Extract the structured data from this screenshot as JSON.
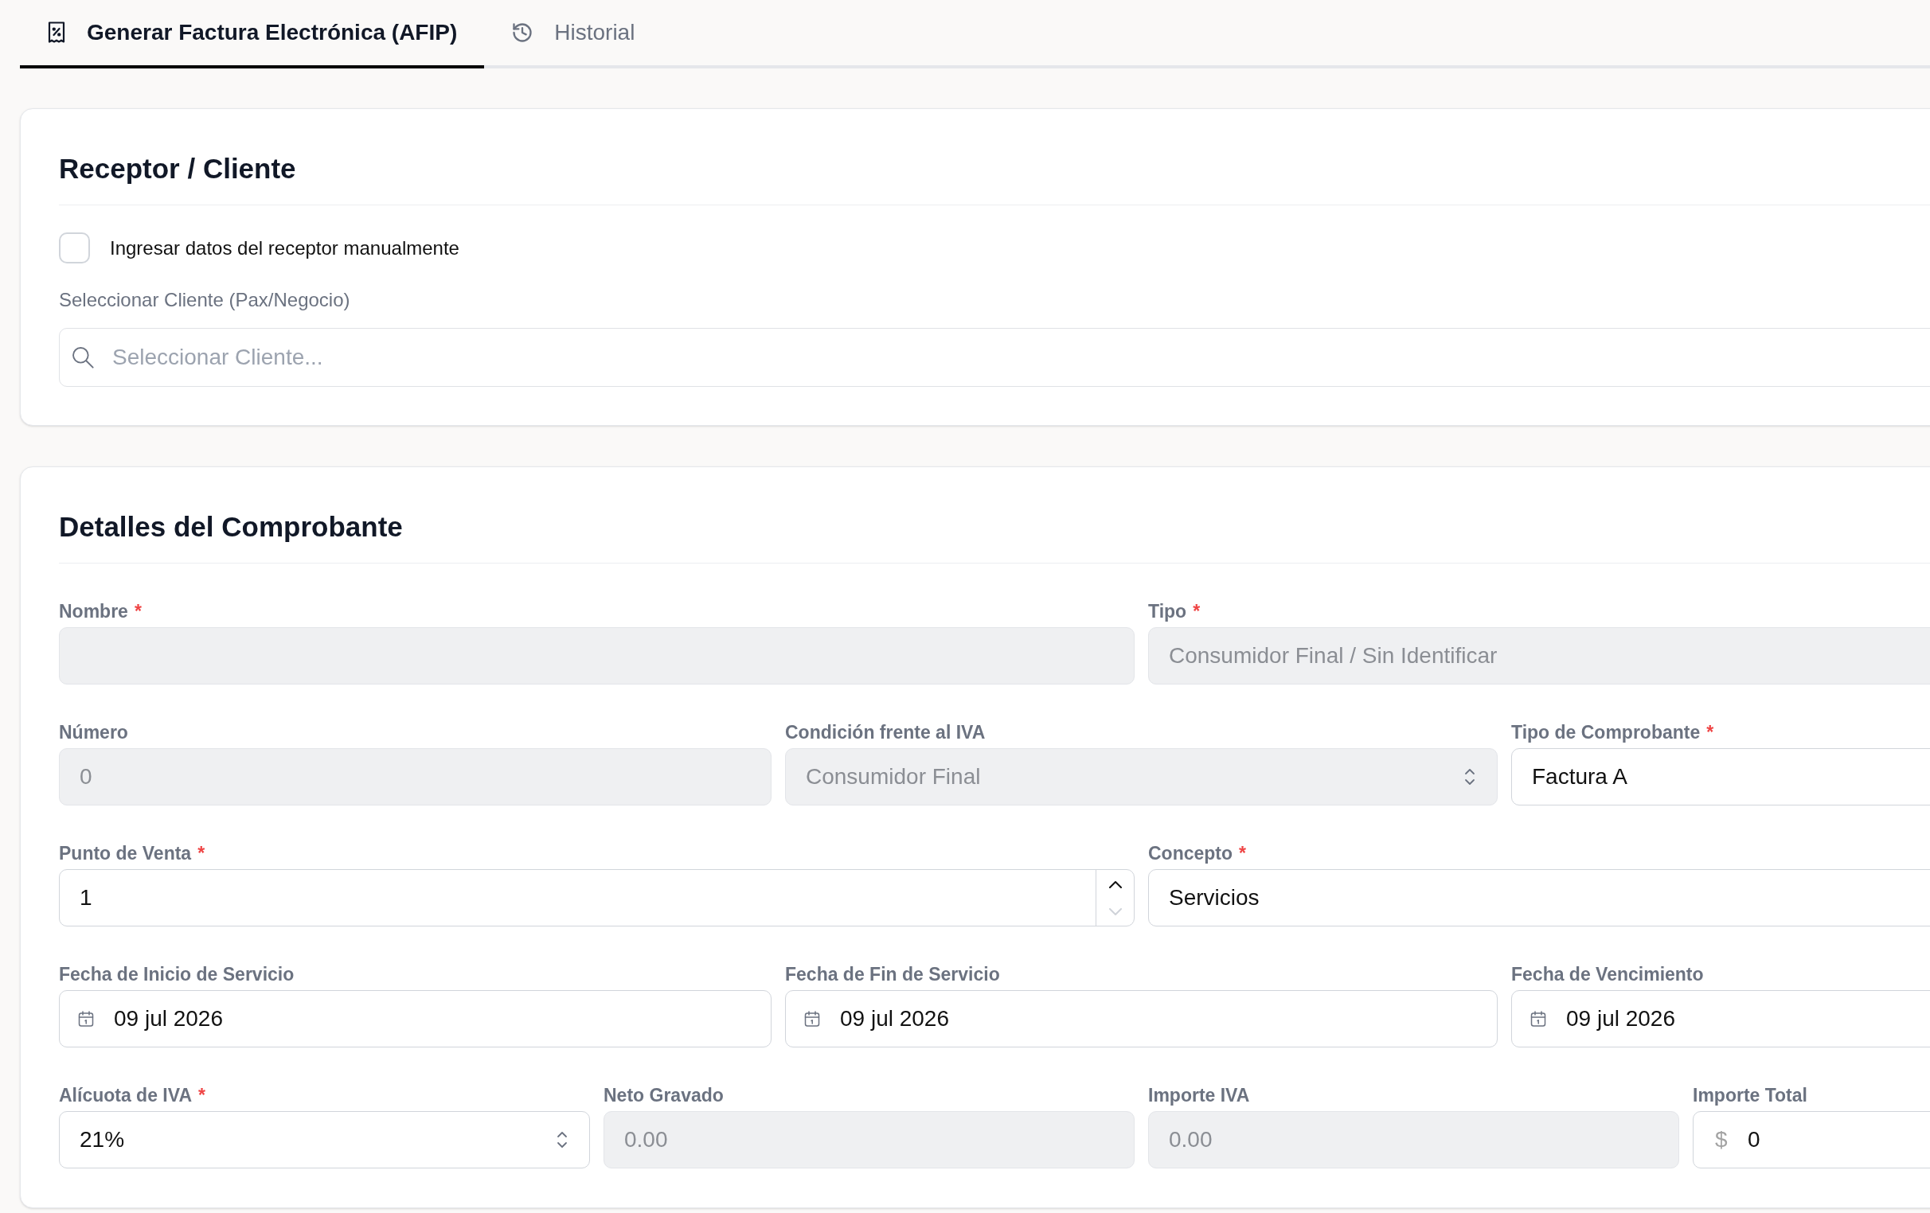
{
  "tabs": [
    {
      "label": "Generar Factura Electrónica (AFIP)",
      "selected": true
    },
    {
      "label": "Historial",
      "selected": false
    }
  ],
  "receptor": {
    "title": "Receptor / Cliente",
    "manual_entry": {
      "label": "Ingresar datos del receptor manualmente",
      "checked": false
    },
    "client": {
      "label": "Seleccionar Cliente (Pax/Negocio)",
      "placeholder": "Seleccionar Cliente..."
    }
  },
  "comprobante": {
    "title": "Detalles del Comprobante",
    "rows": [
      {
        "fields": [
          {
            "label": "Nombre",
            "required_mark": "*",
            "kind": "text",
            "disabled": true
          },
          {
            "label": "Tipo",
            "required_mark": "*",
            "kind": "text",
            "disabled": true,
            "value": "Consumidor Final / Sin Identificar"
          }
        ]
      },
      {
        "fields": [
          {
            "label": "Número",
            "kind": "text",
            "disabled": true,
            "value": "0"
          },
          {
            "label": "Condición frente al IVA",
            "kind": "select",
            "disabled": true,
            "value": "Consumidor Final"
          },
          {
            "label": "Tipo de Comprobante",
            "required_mark": "*",
            "kind": "text",
            "disabled": false,
            "value": "Factura A"
          }
        ]
      },
      {
        "fields": [
          {
            "label": "Punto de Venta",
            "required_mark": "*",
            "kind": "number",
            "disabled": false,
            "value": "1",
            "decrement_disabled": true
          },
          {
            "label": "Concepto",
            "required_mark": "*",
            "kind": "text",
            "disabled": false,
            "value": "Servicios"
          }
        ]
      },
      {
        "fields": [
          {
            "label": "Fecha de Inicio de Servicio",
            "kind": "date",
            "disabled": false,
            "value": "09 jul 2026"
          },
          {
            "label": "Fecha de Fin de Servicio",
            "kind": "date",
            "disabled": false,
            "value": "09 jul 2026"
          },
          {
            "label": "Fecha de Vencimiento",
            "kind": "date",
            "disabled": false,
            "value": "09 jul 2026"
          }
        ]
      },
      {
        "fields": [
          {
            "label": "Alícuota de IVA",
            "required_mark": "*",
            "kind": "select",
            "disabled": false,
            "value": "21%"
          },
          {
            "label": "Neto Gravado",
            "kind": "text",
            "disabled": true,
            "value": "0.00"
          },
          {
            "label": "Importe IVA",
            "kind": "text",
            "disabled": true,
            "value": "0.00"
          },
          {
            "label": "Importe Total",
            "kind": "currency",
            "disabled": false,
            "prefix": "$",
            "value": "0"
          }
        ]
      }
    ]
  }
}
